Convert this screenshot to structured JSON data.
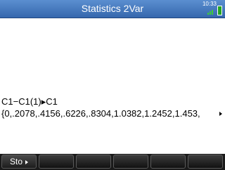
{
  "header": {
    "title": "Statistics 2Var",
    "clock": "10:33"
  },
  "history": {
    "command": "C1−C1(1)▸C1",
    "result": "{0,.2078,.4156,.6226,.8304,1.0382,1.2452,1.453,"
  },
  "menu": {
    "sto_label": "Sto",
    "empty_keys": [
      "",
      "",
      "",
      "",
      ""
    ]
  },
  "colors": {
    "titlebar": "#3567ad",
    "battery": "#24a424",
    "menubar": "#1a1a1a"
  }
}
